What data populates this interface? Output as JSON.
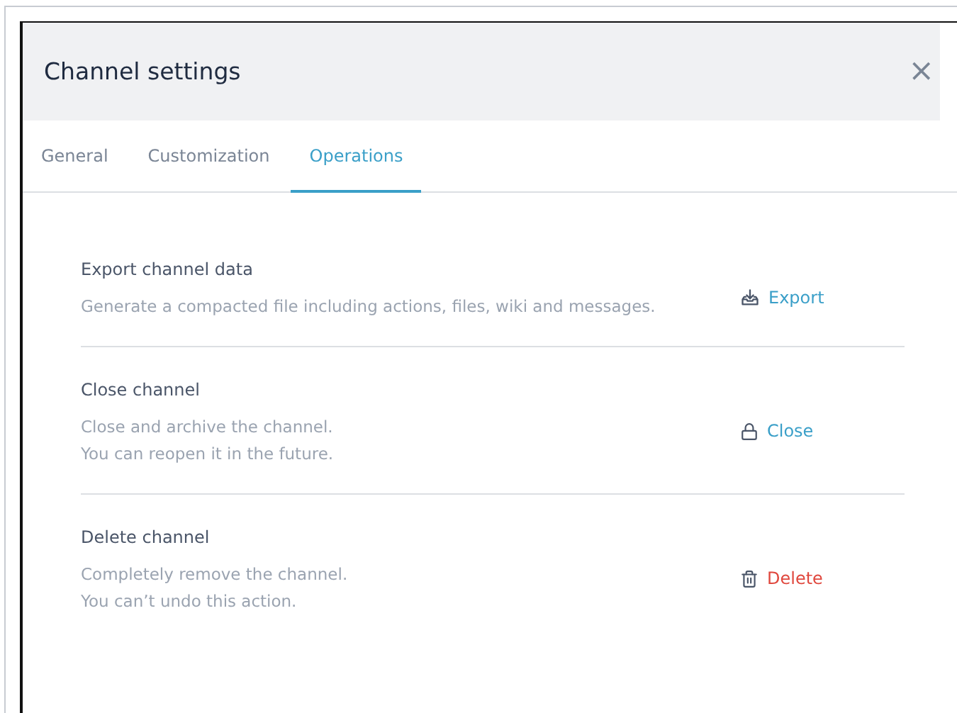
{
  "dialog": {
    "title": "Channel settings",
    "close": "×"
  },
  "tabs": [
    {
      "label": "General",
      "selected": false
    },
    {
      "label": "Customization",
      "selected": false
    },
    {
      "label": "Operations",
      "selected": true
    }
  ],
  "operations": [
    {
      "title": "Export channel data",
      "description": [
        "Generate a compacted file including actions, files, wiki and messages."
      ],
      "action": {
        "kind": "export",
        "label": "Export",
        "color": "#3a9fc8"
      }
    },
    {
      "title": "Close channel",
      "description": [
        "Close and archive the channel.",
        "You can reopen it in the future."
      ],
      "action": {
        "kind": "lock",
        "label": "Close",
        "color": "#3a9fc8"
      }
    },
    {
      "title": "Delete channel",
      "description": [
        "Completely remove the channel.",
        "You can’t undo this action."
      ],
      "action": {
        "kind": "trash",
        "label": "Delete",
        "color": "#e0483e"
      }
    }
  ]
}
